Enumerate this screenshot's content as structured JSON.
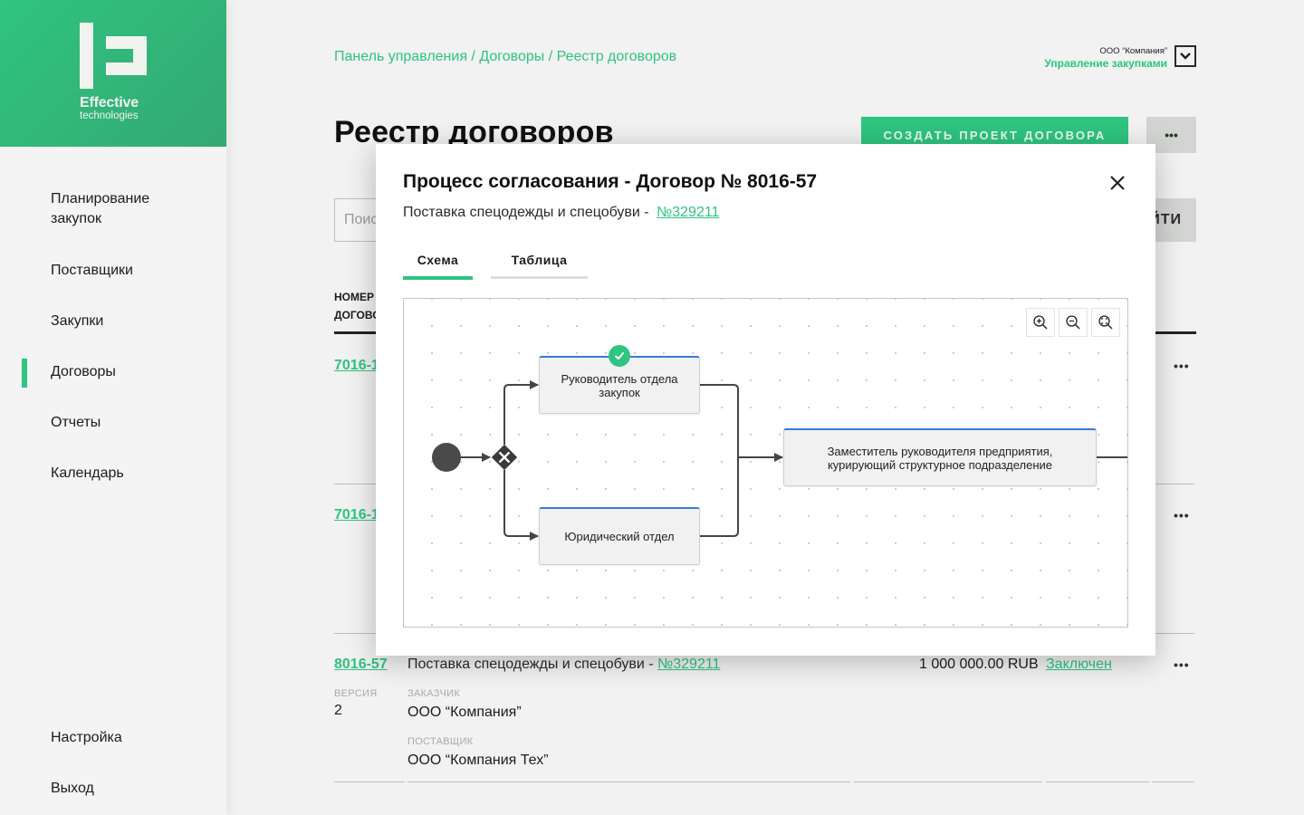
{
  "brand": {
    "name_line1": "Effective",
    "name_line2": "technologies",
    "accent": "#2fc480"
  },
  "sidebar": {
    "items": [
      {
        "label": "Планирование закупок",
        "active": false
      },
      {
        "label": "Поставщики",
        "active": false
      },
      {
        "label": "Закупки",
        "active": false
      },
      {
        "label": "Договоры",
        "active": true
      },
      {
        "label": "Отчеты",
        "active": false
      },
      {
        "label": "Календарь",
        "active": false
      }
    ],
    "bottom_items": [
      {
        "label": "Настройка"
      },
      {
        "label": "Выход"
      }
    ]
  },
  "header": {
    "breadcrumb": [
      "Панель управления",
      "Договоры",
      "Реестр договоров"
    ],
    "breadcrumb_sep": " / ",
    "org_name": "ООО “Компания”",
    "org_role": "Управление закупками",
    "org_toggle_icon": "chevron-down-icon"
  },
  "page": {
    "title": "Реестр договоров",
    "create_button": "СОЗДАТЬ ПРОЕКТ ДОГОВОРА",
    "more_button": "•••",
    "search_placeholder": "Поиск",
    "find_button": "НАЙТИ",
    "column_header_line1": "НОМЕР",
    "column_header_line2": "ДОГОВОРА"
  },
  "table": {
    "rows": [
      {
        "number": "7016-1"
      },
      {
        "number": "7016-1"
      },
      {
        "number": "8016-57",
        "description": "Поставка спецодежды и спецобуви - ",
        "lot_link": "№329211",
        "version_label": "ВЕРСИЯ",
        "version": "2",
        "customer_label": "ЗАКАЗЧИК",
        "customer": "ООО “Компания”",
        "supplier_label": "ПОСТАВЩИК",
        "supplier": "ООО “Компания Тех”",
        "amount": "1 000 000.00 RUB",
        "status": "Заключен"
      }
    ],
    "row_more": "•••"
  },
  "modal": {
    "title": "Процесс согласования - Договор № 8016-57",
    "subtitle": "Поставка спецодежды и спецобуви - ",
    "subtitle_link": "№329211",
    "tabs": [
      {
        "label": "Схема",
        "active": true
      },
      {
        "label": "Таблица",
        "active": false
      }
    ],
    "zoom_controls": [
      "zoom-in-icon",
      "zoom-out-icon",
      "zoom-fit-icon"
    ],
    "diagram": {
      "nodes": [
        {
          "label": "Руководитель отдела закупок",
          "completed": true
        },
        {
          "label": "Юридический отдел",
          "completed": false
        },
        {
          "label": "Заместитель руководителя предприятия, курирующий структурное подразделение",
          "completed": false
        }
      ],
      "start_event": "start",
      "gateway": "exclusive"
    }
  }
}
